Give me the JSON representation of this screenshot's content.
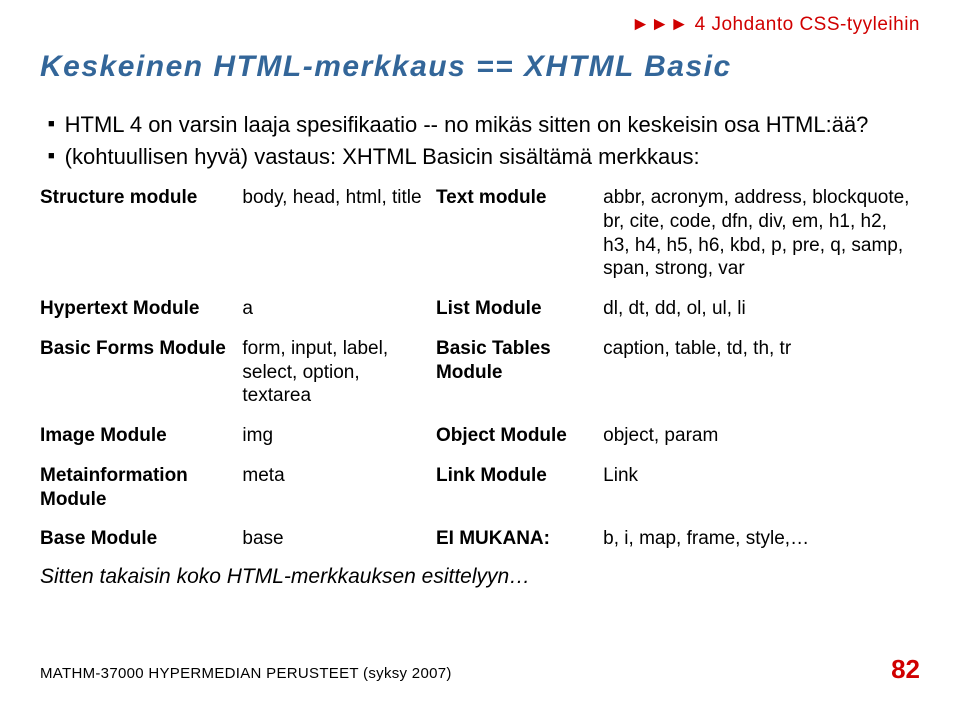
{
  "chapter_marker": "►►► 4 Johdanto CSS-tyyleihin",
  "title": "Keskeinen HTML-merkkaus == XHTML Basic",
  "bullet1": "HTML 4 on varsin laaja spesifikaatio -- no mikäs sitten on keskeisin osa HTML:ää?",
  "bullet2": "(kohtuullisen hyvä) vastaus: XHTML Basicin sisältämä merkkaus:",
  "rows": [
    {
      "k1": "Structure module",
      "v1": "body, head, html, title",
      "k2": "Text module",
      "v2": "abbr, acronym, address, blockquote, br, cite, code, dfn, div, em, h1, h2, h3, h4, h5, h6, kbd, p, pre, q, samp, span, strong, var"
    },
    {
      "k1": "Hypertext Module",
      "v1": "a",
      "k2": "List Module",
      "v2": "dl, dt, dd, ol, ul, li"
    },
    {
      "k1": "Basic Forms Module",
      "v1": "form, input, label, select, option, textarea",
      "k2": "Basic Tables Module",
      "v2": "caption, table, td, th, tr"
    },
    {
      "k1": "Image Module",
      "v1": "img",
      "k2": "Object Module",
      "v2": "object, param"
    },
    {
      "k1": "Metainformation Module",
      "v1": "meta",
      "k2": "Link Module",
      "v2": "Link"
    },
    {
      "k1": "Base Module",
      "v1": "base",
      "k2": "EI MUKANA:",
      "v2": "b, i, map, frame, style,…"
    }
  ],
  "closing": "Sitten takaisin koko HTML-merkkauksen esittelyyn…",
  "footer_course": "MATHM-37000 HYPERMEDIAN PERUSTEET (syksy 2007)",
  "page_number": "82"
}
